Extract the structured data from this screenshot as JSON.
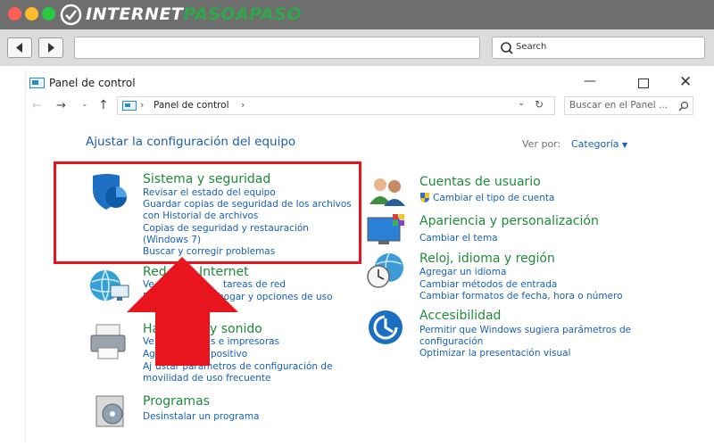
{
  "site": {
    "logo_main": "INTERNET",
    "logo_accent": "PASOAPASO"
  },
  "browser": {
    "search_label": "Search",
    "back_icon": "back-arrow-icon",
    "forward_icon": "forward-arrow-icon"
  },
  "window": {
    "title": "Panel de control",
    "breadcrumb_root": "Panel de control",
    "search_placeholder": "Buscar en el Panel ...",
    "heading": "Ajustar la configuración del equipo",
    "view_by_label": "Ver por:",
    "view_by_value": "Categoría"
  },
  "categories_left": [
    {
      "title": "Sistema y seguridad",
      "links": [
        "Revisar el estado del equipo",
        "Guardar copias de seguridad de los archivos",
        "con Historial de archivos",
        "Copias de seguridad y restauración",
        "(Windows 7)",
        "Buscar y corregir problemas"
      ]
    },
    {
      "title": "Redes e Internet",
      "title_visible": "Red",
      "title_visible2": "Internet",
      "links": [
        "Ve",
        "tareas de red",
        "Ele",
        "hogar y opciones de uso"
      ]
    },
    {
      "title": "Hardware y sonido",
      "title_visible": "Ha",
      "title_visible2": "y sonido",
      "links": [
        "Ve",
        "s e impresoras",
        "Ag",
        "positivo",
        "Aj",
        "ustar parámetros de configuración de",
        "movilidad de uso frecuente"
      ]
    },
    {
      "title": "Programas",
      "links": [
        "Desinstalar un programa"
      ]
    }
  ],
  "categories_right": [
    {
      "title": "Cuentas de usuario",
      "links": [
        "Cambiar el tipo de cuenta"
      ]
    },
    {
      "title": "Apariencia y personalización",
      "links": [
        "Cambiar el tema"
      ]
    },
    {
      "title": "Reloj, idioma y región",
      "links": [
        "Agregar un idioma",
        "Cambiar métodos de entrada",
        "Cambiar formatos de fecha, hora o número"
      ]
    },
    {
      "title": "Accesibilidad",
      "links": [
        "Permitir que Windows sugiera parámetros de",
        "configuración",
        "Optimizar la presentación visual"
      ]
    }
  ],
  "colors": {
    "highlight_box": "#e8141e",
    "arrow": "#e8141e",
    "category_green": "#1e8a3a",
    "link_blue": "#1561b8"
  }
}
